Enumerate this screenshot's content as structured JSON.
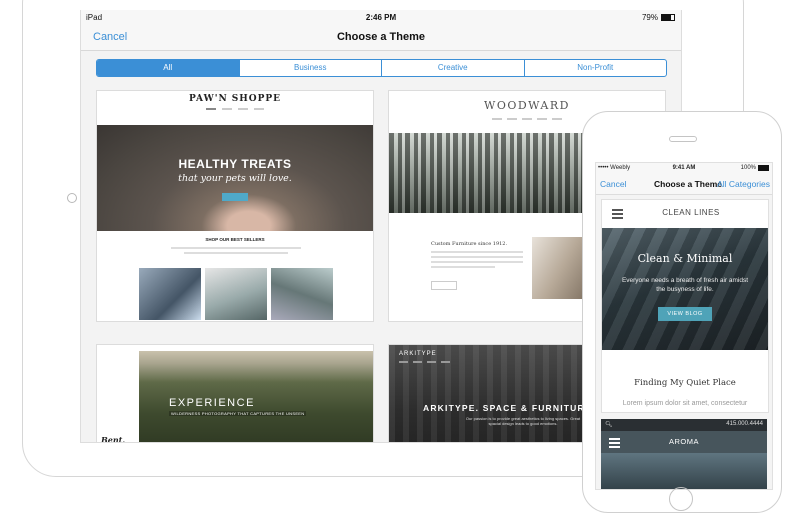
{
  "ipad": {
    "status": {
      "carrier": "iPad",
      "time": "2:46 PM",
      "battery": "79%"
    },
    "nav": {
      "cancel": "Cancel",
      "title": "Choose a Theme"
    },
    "tabs": [
      {
        "label": "All",
        "active": true
      },
      {
        "label": "Business",
        "active": false
      },
      {
        "label": "Creative",
        "active": false
      },
      {
        "label": "Non-Profit",
        "active": false
      }
    ],
    "themes": {
      "pawn_shoppe": {
        "logo": "PAW'N SHOPPE",
        "hero_title": "HEALTHY TREATS",
        "hero_subtitle": "that your pets will love.",
        "section_title": "SHOP OUR BEST SELLERS"
      },
      "woodward": {
        "logo": "WOODWARD",
        "heading": "Custom Furniture since 1912."
      },
      "experience": {
        "hero_title": "EXPERIENCE",
        "hero_subtitle": "WILDERNESS PHOTOGRAPHY THAT CAPTURES THE UNSEEN"
      },
      "arkitype": {
        "logo": "ARKITYPE",
        "headline": "ARKITYPE. SPACE & FURNITURE",
        "subline": "Our passion is to provide great aesthetics to living spaces. Great spacial design leads to good emotions."
      }
    }
  },
  "iphone": {
    "status": {
      "carrier": "••••• Weebly",
      "time": "9:41 AM",
      "battery": "100%"
    },
    "nav": {
      "cancel": "Cancel",
      "title": "Choose a Theme",
      "categories": "All Categories"
    },
    "theme_clean_lines": {
      "name": "CLEAN LINES",
      "hero_title": "Clean & Minimal",
      "hero_text": "Everyone needs a breath of fresh air amidst the busyness of life.",
      "button": "VIEW BLOG",
      "post_title": "Finding My Quiet Place",
      "post_excerpt": "Lorem ipsum dolor sit amet, consectetur"
    },
    "theme_aroma": {
      "phone": "415.000.4444",
      "name": "AROMA"
    }
  },
  "colors": {
    "accent": "#3b8fd6",
    "button_teal": "#4fa3b8"
  }
}
